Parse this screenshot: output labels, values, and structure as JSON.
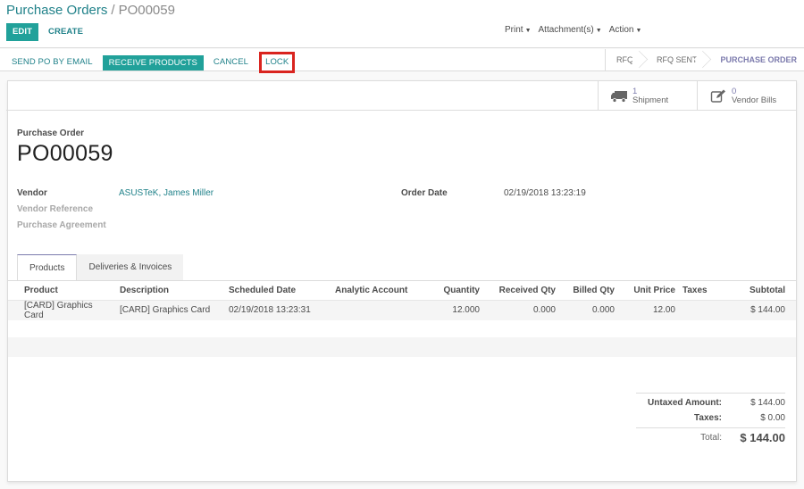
{
  "breadcrumb": {
    "parent": "Purchase Orders",
    "separator": "/",
    "current": "PO00059"
  },
  "toolbar": {
    "edit_label": "EDIT",
    "create_label": "CREATE"
  },
  "sidebar_menus": [
    {
      "label": "Print"
    },
    {
      "label": "Attachment(s)"
    },
    {
      "label": "Action"
    }
  ],
  "statusbar": {
    "buttons": {
      "send_po": "SEND PO BY EMAIL",
      "receive_products": "RECEIVE PRODUCTS",
      "cancel": "CANCEL",
      "lock": "LOCK"
    },
    "stages": [
      {
        "label": "RFQ",
        "active": false
      },
      {
        "label": "RFQ SENT",
        "active": false
      },
      {
        "label": "PURCHASE ORDER",
        "active": true
      }
    ],
    "highlight_color": "#d9241f"
  },
  "smart_buttons": [
    {
      "icon": "truck-icon",
      "count": "1",
      "label": "Shipment"
    },
    {
      "icon": "edit-icon",
      "count": "0",
      "label": "Vendor Bills"
    }
  ],
  "form": {
    "title_label": "Purchase Order",
    "title": "PO00059",
    "fields": {
      "vendor_label": "Vendor",
      "vendor_value": "ASUSTeK, James Miller",
      "vendor_reference_label": "Vendor Reference",
      "purchase_agreement_label": "Purchase Agreement",
      "order_date_label": "Order Date",
      "order_date_value": "02/19/2018 13:23:19"
    }
  },
  "tabs": [
    {
      "label": "Products",
      "active": true
    },
    {
      "label": "Deliveries & Invoices",
      "active": false
    }
  ],
  "order_lines": {
    "columns": [
      "Product",
      "Description",
      "Scheduled Date",
      "Analytic Account",
      "Quantity",
      "Received Qty",
      "Billed Qty",
      "Unit Price",
      "Taxes",
      "Subtotal"
    ],
    "rows": [
      {
        "product": "[CARD] Graphics Card",
        "description": "[CARD] Graphics Card",
        "scheduled_date": "02/19/2018 13:23:31",
        "analytic_account": "",
        "quantity": "12.000",
        "received_qty": "0.000",
        "billed_qty": "0.000",
        "unit_price": "12.00",
        "taxes": "",
        "subtotal": "$ 144.00"
      }
    ]
  },
  "totals": {
    "untaxed_label": "Untaxed Amount:",
    "untaxed_value": "$ 144.00",
    "taxes_label": "Taxes:",
    "taxes_value": "$ 0.00",
    "total_label": "Total:",
    "total_value": "$ 144.00"
  },
  "colors": {
    "primary": "#21a19a",
    "link": "#21828a",
    "accent": "#7c7bad"
  }
}
